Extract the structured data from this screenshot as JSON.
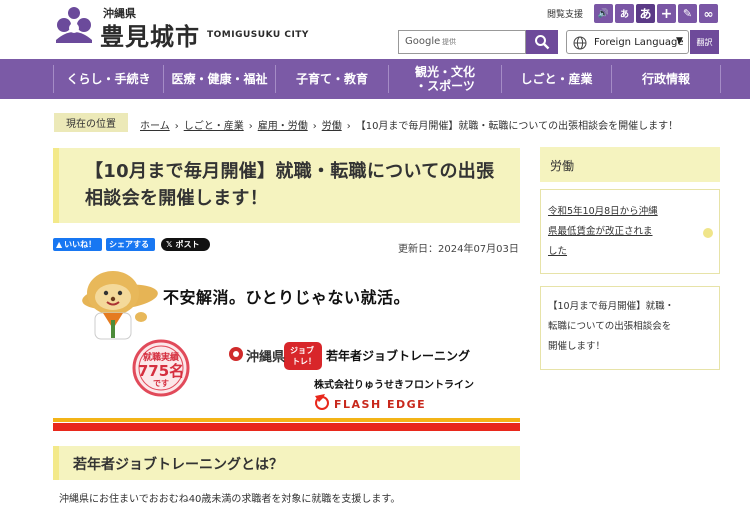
{
  "header": {
    "pref": "沖縄県",
    "city": "豊見城市",
    "city_en": "TOMIGUSUKU CITY",
    "support_label": "閲覧支援",
    "tools": [
      "🔊",
      "あ",
      "あ",
      "+",
      "✎",
      "∞"
    ],
    "search_brand": "Google",
    "search_suffix": "提供",
    "language_label": "Foreign Language",
    "translate_label": "翻訳"
  },
  "nav": {
    "items": [
      "くらし・手続き",
      "医療・健康・福祉",
      "子育て・教育",
      "観光・文化\n・スポーツ",
      "しごと・産業",
      "行政情報"
    ]
  },
  "breadcrumb": {
    "label": "現在の位置",
    "items": [
      "ホーム",
      "しごと・産業",
      "雇用・労働",
      "労働"
    ],
    "current": "【10月まで毎月開催】就職・転職についての出張相談会を開催します！"
  },
  "article": {
    "title": "【10月まで毎月開催】就職・転職についての出張相談会を開催します！",
    "share_like": "いいね！",
    "share_share": "シェアする",
    "share_post": "ポスト",
    "updated": "更新日：2024年07月03日",
    "banner": {
      "catch": "不安解消。ひとりじゃない就活。",
      "badge_line1": "就職実績",
      "badge_line2": "775名",
      "badge_line3": "です",
      "org1": "沖縄県",
      "program_tag1": "ジョブ",
      "program_tag2": "トレ！",
      "program": "若年者ジョブトレーニング",
      "company": "株式会社りゅうせきフロントライン",
      "partner": "FLASH EDGE"
    },
    "section_heading": "若年者ジョブトレーニングとは？",
    "body": "沖縄県にお住まいでおおむね40歳未満の求職者を対象に就職を支援します。"
  },
  "sidebar": {
    "heading": "労働",
    "link1": [
      "令和5年10月8日から沖縄",
      "県最低賃金が改正されま",
      "した"
    ],
    "current": [
      "【10月まで毎月開催】就職・",
      "転職についての出張相談会を",
      "開催します！"
    ]
  },
  "colors": {
    "purple": "#7b5aa6",
    "yellow_bg": "#f5f3bf",
    "yellow_accent": "#f3e98a"
  }
}
